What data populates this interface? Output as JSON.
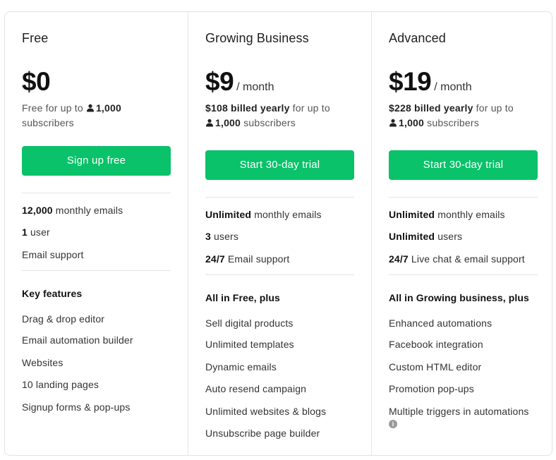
{
  "plans": [
    {
      "name": "Free",
      "price": "$0",
      "period": "",
      "billing_bold": "",
      "billing_text": "Free for up to",
      "subscribers_count": "1,000",
      "subscribers_label": "subscribers",
      "button_label": "Sign up free",
      "usage": [
        {
          "bold": "12,000",
          "text": "monthly emails"
        },
        {
          "bold": "1",
          "text": "user"
        },
        {
          "bold": "",
          "text": "Email support"
        }
      ],
      "features_title": "Key features",
      "features": [
        "Drag & drop editor",
        "Email automation builder",
        "Websites",
        "10 landing pages",
        "Signup forms & pop-ups"
      ]
    },
    {
      "name": "Growing Business",
      "price": "$9",
      "period": "/ month",
      "billing_bold": "$108 billed yearly",
      "billing_text": "for up to",
      "subscribers_count": "1,000",
      "subscribers_label": "subscribers",
      "button_label": "Start 30-day trial",
      "usage": [
        {
          "bold": "Unlimited",
          "text": "monthly emails"
        },
        {
          "bold": "3",
          "text": "users"
        },
        {
          "bold": "24/7",
          "text": "Email support"
        }
      ],
      "features_title": "All in Free, plus",
      "features": [
        "Sell digital products",
        "Unlimited templates",
        "Dynamic emails",
        "Auto resend campaign",
        "Unlimited websites & blogs",
        "Unsubscribe page builder"
      ]
    },
    {
      "name": "Advanced",
      "price": "$19",
      "period": "/ month",
      "billing_bold": "$228 billed yearly",
      "billing_text": "for up to",
      "subscribers_count": "1,000",
      "subscribers_label": "subscribers",
      "button_label": "Start 30-day trial",
      "usage": [
        {
          "bold": "Unlimited",
          "text": "monthly emails"
        },
        {
          "bold": "Unlimited",
          "text": "users"
        },
        {
          "bold": "24/7",
          "text": "Live chat & email support"
        }
      ],
      "features_title": "All in Growing business, plus",
      "features": [
        "Enhanced automations",
        "Facebook integration",
        "Custom HTML editor",
        "Promotion pop-ups",
        "Multiple triggers in automations"
      ]
    }
  ],
  "icons": {
    "subscriber": "user-icon",
    "info": "info-icon"
  },
  "colors": {
    "button": "#09c269",
    "text": "#1f1f1f",
    "muted": "#555555",
    "divider": "#e3e3e3"
  }
}
